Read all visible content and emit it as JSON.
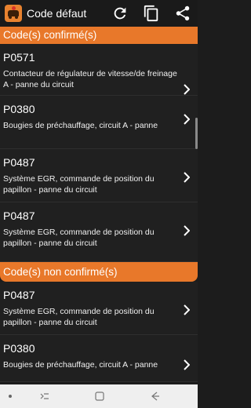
{
  "appbar": {
    "title": "Code défaut",
    "app_icon": "car-engine-icon",
    "actions": [
      "refresh-icon",
      "copy-icon",
      "share-icon"
    ]
  },
  "sections": {
    "confirmed": {
      "title": "Code(s) confirmé(s)",
      "items": [
        {
          "code": "P0571",
          "desc": "Contacteur de régulateur de vitesse/de freinage A - panne du circuit"
        },
        {
          "code": "P0380",
          "desc": "Bougies de préchauffage, circuit A - panne"
        },
        {
          "code": "P0487",
          "desc": "Système EGR, commande de position du papillon - panne du circuit"
        },
        {
          "code": "P0487",
          "desc": "Système EGR, commande de position du papillon - panne du circuit"
        }
      ]
    },
    "unconfirmed": {
      "title": "Code(s) non confirmé(s)",
      "items": [
        {
          "code": "P0487",
          "desc": "Système EGR, commande de position du papillon - panne du circuit"
        },
        {
          "code": "P0380",
          "desc": "Bougies de préchauffage, circuit A - panne"
        }
      ]
    }
  },
  "navbar": {
    "buttons": [
      "dot-icon",
      "recents-icon",
      "home-icon",
      "back-icon"
    ]
  },
  "colors": {
    "accent": "#e8782a",
    "background": "#1c1c1c",
    "text": "#ffffff"
  }
}
